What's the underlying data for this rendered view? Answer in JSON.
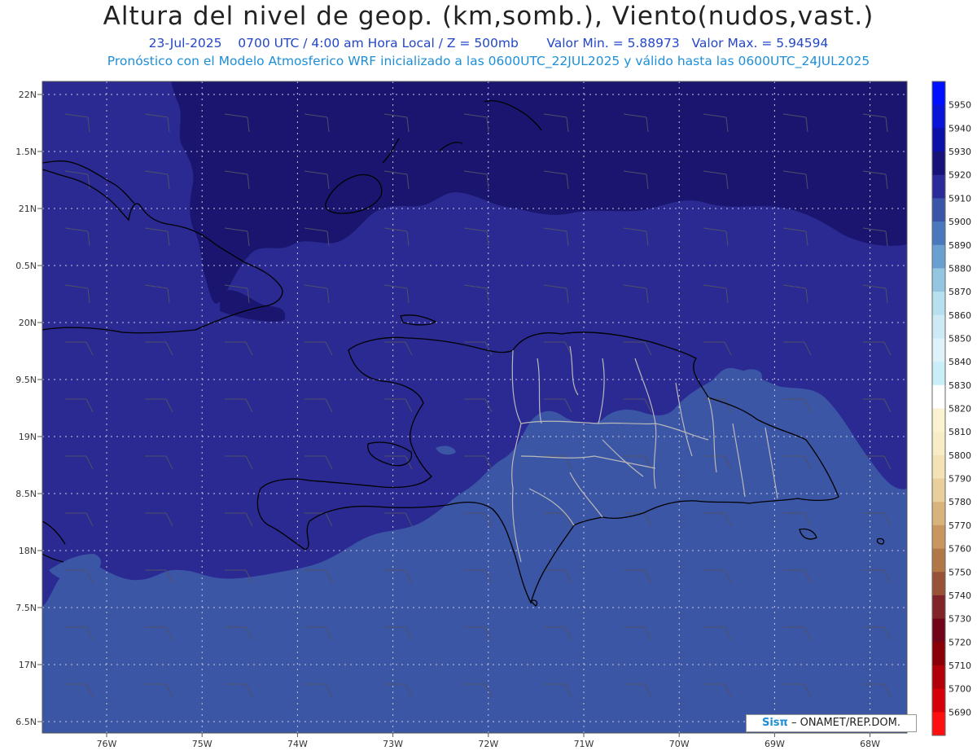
{
  "header": {
    "title": "Altura del nivel de geop. (km,somb.), Viento(nudos,vast.)",
    "subtitle_date": "23-Jul-2025",
    "subtitle_time": "0700 UTC / 4:00 am Hora Local / Z = 500mb",
    "subtitle_min": "Valor Min. = 5.88973",
    "subtitle_max": "Valor Max. = 5.94594",
    "model_line": "Pronóstico con el Modelo Atmosferico WRF inicializado a las 0600UTC_22JUL2025 y válido hasta las  0600UTC_24JUL2025"
  },
  "axes": {
    "lat_labels": [
      "22N",
      "1.5N",
      "21N",
      "0.5N",
      "20N",
      "9.5N",
      "19N",
      "8.5N",
      "18N",
      "7.5N",
      "17N",
      "6.5N"
    ],
    "lon_labels": [
      "76W",
      "75W",
      "74W",
      "73W",
      "72W",
      "71W",
      "70W",
      "69W",
      "68W"
    ]
  },
  "colorbar": {
    "levels": [
      {
        "value": "5950",
        "color": "#0010ff"
      },
      {
        "value": "5940",
        "color": "#0a14d6"
      },
      {
        "value": "5930",
        "color": "#0c10a8"
      },
      {
        "value": "5920",
        "color": "#161278"
      },
      {
        "value": "5910",
        "color": "#2a2a98"
      },
      {
        "value": "5900",
        "color": "#3a55a8"
      },
      {
        "value": "5890",
        "color": "#4a78bc"
      },
      {
        "value": "5880",
        "color": "#6aa0d0"
      },
      {
        "value": "5870",
        "color": "#94c6e2"
      },
      {
        "value": "5860",
        "color": "#b6e0ee"
      },
      {
        "value": "5850",
        "color": "#cdeaf4"
      },
      {
        "value": "5840",
        "color": "#dff2fa"
      },
      {
        "value": "5830",
        "color": "#c9eef8"
      },
      {
        "value": "5820",
        "color": "#ffffff"
      },
      {
        "value": "5810",
        "color": "#fbf2d2"
      },
      {
        "value": "5800",
        "color": "#f7ecc6"
      },
      {
        "value": "5790",
        "color": "#f2e2b4"
      },
      {
        "value": "5780",
        "color": "#e8cf9c"
      },
      {
        "value": "5770",
        "color": "#d8b47c"
      },
      {
        "value": "5760",
        "color": "#c99660"
      },
      {
        "value": "5750",
        "color": "#b07846"
      },
      {
        "value": "5740",
        "color": "#985238"
      },
      {
        "value": "5730",
        "color": "#80242a"
      },
      {
        "value": "5720",
        "color": "#700418"
      },
      {
        "value": "5710",
        "color": "#8a0008"
      },
      {
        "value": "5700",
        "color": "#b20008"
      },
      {
        "value": "5690",
        "color": "#d6000a"
      },
      {
        "value": "",
        "color": "#ff1010"
      }
    ]
  },
  "fill_colors": {
    "high": "#1a1670",
    "mid": "#2a2a92",
    "low": "#3c56a6"
  },
  "credit": {
    "brand": "Sisπ",
    "text": "– ONAMET/REP.DOM."
  }
}
